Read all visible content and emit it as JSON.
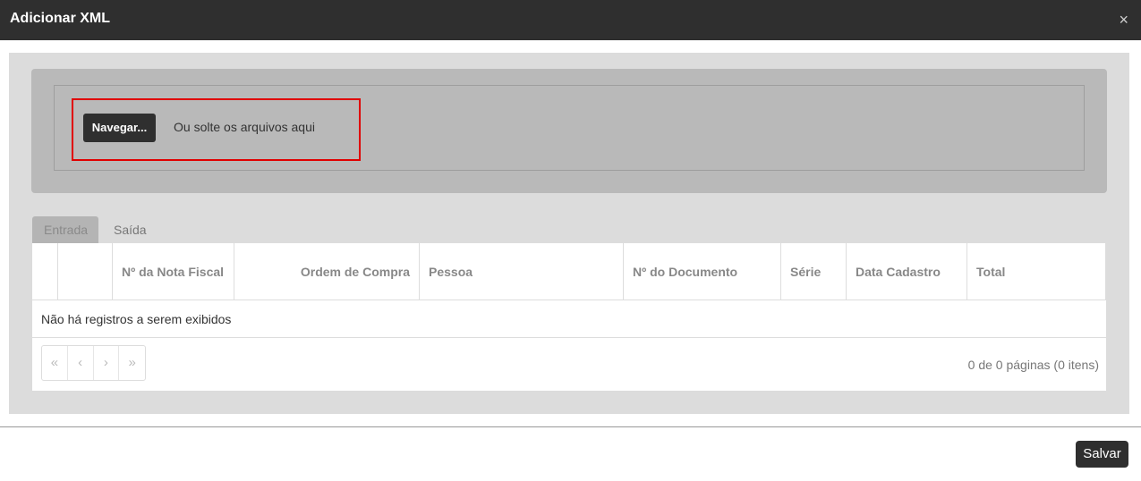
{
  "dialog": {
    "title": "Adicionar XML",
    "close_icon": "×"
  },
  "upload": {
    "browse_label": "Navegar...",
    "drop_hint": "Ou solte os arquivos aqui"
  },
  "tabs": [
    {
      "label": "Entrada",
      "active": true
    },
    {
      "label": "Saída",
      "active": false
    }
  ],
  "grid": {
    "columns": [
      "",
      "",
      "Nº da Nota Fiscal",
      "Ordem de Compra",
      "Pessoa",
      "Nº do Documento",
      "Série",
      "Data Cadastro",
      "Total"
    ],
    "empty_message": "Não há registros a serem exibidos",
    "pager": {
      "first": "«",
      "prev": "‹",
      "next": "›",
      "last": "»"
    },
    "page_info": "0 de 0 páginas (0 itens)"
  },
  "footer": {
    "save_label": "Salvar"
  }
}
